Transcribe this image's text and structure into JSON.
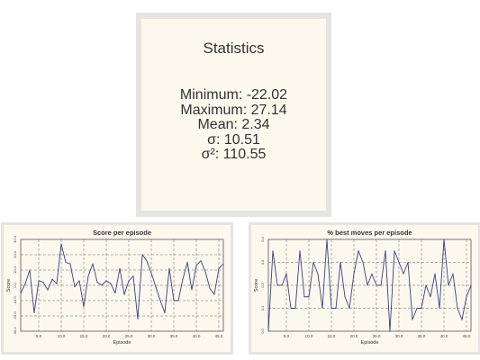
{
  "statistics": {
    "title": "Statistics",
    "minimum": "Minimum: -22.02",
    "maximum": "Maximum: 27.14",
    "mean": "Mean: 2.34",
    "sigma": "σ: 10.51",
    "variance": "σ²: 110.55"
  },
  "colors": {
    "panel_background": "#fbf8ee",
    "frame_background": "#e6e4e0",
    "line": "#3a3f85",
    "grid": "#666666"
  },
  "chart_data": [
    {
      "type": "line",
      "title": "Score per episode",
      "xlabel": "Episode",
      "ylabel": "Score",
      "xlim": [
        1,
        46
      ],
      "ylim": [
        -30,
        30
      ],
      "grid": true,
      "xticks": [
        5,
        10,
        15,
        20,
        25,
        30,
        35,
        40,
        45
      ],
      "xtick_labels": [
        "5.0",
        "10.0",
        "15.0",
        "20.0",
        "25.0",
        "30.0",
        "35.0",
        "40.0",
        "45.0"
      ],
      "yticks": [
        -30,
        -20,
        -10,
        0,
        10,
        20,
        30
      ],
      "ytick_labels": [
        "-30.0",
        "-20.0",
        "-10.0",
        "0.0",
        "10.0",
        "20.0",
        "30.0"
      ],
      "x": [
        1,
        2,
        3,
        4,
        5,
        6,
        7,
        8,
        9,
        10,
        11,
        12,
        13,
        14,
        15,
        16,
        17,
        18,
        19,
        20,
        21,
        22,
        23,
        24,
        25,
        26,
        27,
        28,
        29,
        30,
        31,
        32,
        33,
        34,
        35,
        36,
        37,
        38,
        39,
        40,
        41,
        42,
        43,
        44,
        45,
        46
      ],
      "values": [
        -5,
        1,
        10,
        -18,
        3,
        2,
        -3,
        4,
        1,
        27,
        15,
        14,
        -1,
        3,
        -14,
        6,
        14,
        2,
        0,
        3,
        1,
        -5,
        11,
        -6,
        3,
        6,
        -22,
        20,
        16,
        8,
        -1,
        -10,
        -18,
        11,
        -10,
        -10,
        4,
        15,
        -3,
        13,
        16,
        9,
        -2,
        -6,
        11,
        14
      ]
    },
    {
      "type": "line",
      "title": "% best moves per episode",
      "xlabel": "Episode",
      "ylabel": "Score",
      "xlim": [
        1,
        46
      ],
      "ylim": [
        0,
        0.4
      ],
      "grid": true,
      "xticks": [
        5,
        10,
        15,
        20,
        25,
        30,
        35,
        40,
        45
      ],
      "xtick_labels": [
        "5.0",
        "10.0",
        "15.0",
        "20.0",
        "25.0",
        "30.0",
        "35.0",
        "40.0",
        "45.0"
      ],
      "yticks": [
        0,
        0.1,
        0.2,
        0.3,
        0.4
      ],
      "ytick_labels": [
        "0.0",
        "0.1",
        "0.2",
        "0.3",
        "0.4"
      ],
      "x": [
        1,
        2,
        3,
        4,
        5,
        6,
        7,
        8,
        9,
        10,
        11,
        12,
        13,
        14,
        15,
        16,
        17,
        18,
        19,
        20,
        21,
        22,
        23,
        24,
        25,
        26,
        27,
        28,
        29,
        30,
        31,
        32,
        33,
        34,
        35,
        36,
        37,
        38,
        39,
        40,
        41,
        42,
        43,
        44,
        45,
        46
      ],
      "values": [
        0,
        0.35,
        0.2,
        0.2,
        0.25,
        0.1,
        0.1,
        0.35,
        0.15,
        0.15,
        0.3,
        0.25,
        0.1,
        0.4,
        0.1,
        0.1,
        0.3,
        0.15,
        0.1,
        0.25,
        0.35,
        0.3,
        0.2,
        0.25,
        0.2,
        0.2,
        0.35,
        0,
        0.35,
        0.3,
        0.25,
        0.3,
        0.05,
        0.1,
        0.1,
        0.2,
        0.15,
        0.25,
        0.1,
        0.4,
        0.2,
        0.25,
        0.1,
        0.05,
        0.15,
        0.2
      ]
    }
  ]
}
